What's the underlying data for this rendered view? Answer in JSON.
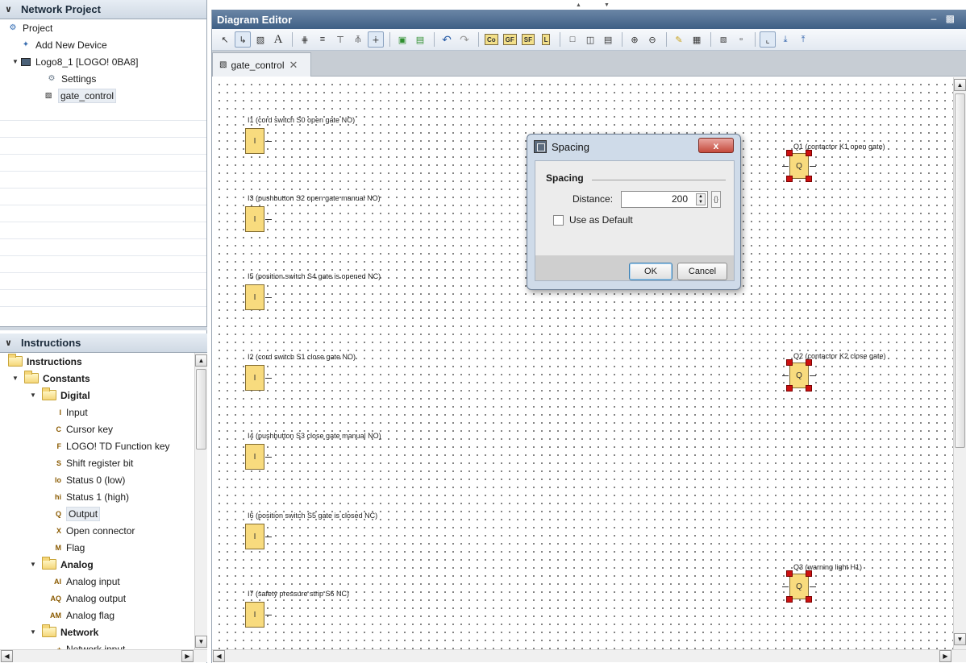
{
  "project_panel": {
    "title": "Network Project",
    "items": [
      {
        "label": "Project"
      },
      {
        "label": "Add New Device"
      },
      {
        "label": "Logo8_1 [LOGO! 0BA8]"
      },
      {
        "label": "Settings"
      },
      {
        "label": "gate_control"
      }
    ]
  },
  "instructions_panel": {
    "title": "Instructions",
    "root": "Instructions",
    "constants": "Constants",
    "digital": "Digital",
    "digital_items": [
      {
        "code": "I",
        "label": "Input"
      },
      {
        "code": "C",
        "label": "Cursor key"
      },
      {
        "code": "F",
        "label": "LOGO! TD Function key"
      },
      {
        "code": "S",
        "label": "Shift register bit"
      },
      {
        "code": "lo",
        "label": "Status 0 (low)"
      },
      {
        "code": "hi",
        "label": "Status 1 (high)"
      },
      {
        "code": "Q",
        "label": "Output"
      },
      {
        "code": "X",
        "label": "Open connector"
      },
      {
        "code": "M",
        "label": "Flag"
      }
    ],
    "analog": "Analog",
    "analog_items": [
      {
        "code": "AI",
        "label": "Analog input"
      },
      {
        "code": "AQ",
        "label": "Analog output"
      },
      {
        "code": "AM",
        "label": "Analog flag"
      }
    ],
    "network": "Network",
    "network_items": [
      {
        "code": "+",
        "label": "Network input"
      }
    ]
  },
  "editor": {
    "title": "Diagram Editor",
    "toolbar_text": {
      "text_tool": "A",
      "co": "Co",
      "gf": "GF",
      "sf": "SF",
      "l": "L"
    },
    "tab": "gate_control",
    "inputs": [
      {
        "name": "I1",
        "label": "I1 (cord switch S0 open gate NO)"
      },
      {
        "name": "I3",
        "label": "I3 (pushbutton S2 open gate manual NO)"
      },
      {
        "name": "I5",
        "label": "I5 (position switch S4 gate is opened NC)"
      },
      {
        "name": "I2",
        "label": "I2 (cord switch S1 close gate NO)"
      },
      {
        "name": "I4",
        "label": "I4 (pushbutton S3 close gate manual NO)"
      },
      {
        "name": "I6",
        "label": "I6 (position switch S5 gate is closed NC)"
      },
      {
        "name": "I7",
        "label": "I7 (safety pressure strip S6 NC)"
      }
    ],
    "input_block_text": "I",
    "outputs": [
      {
        "name": "Q1",
        "label": "Q1 (contactor K1 open gate)"
      },
      {
        "name": "Q2",
        "label": "Q2 (contactor K2 close gate)"
      },
      {
        "name": "Q3",
        "label": "Q3 (warning light H1)"
      }
    ],
    "output_block_text": "Q"
  },
  "dialog": {
    "title": "Spacing",
    "close_label": "x",
    "group": "Spacing",
    "distance_label": "Distance:",
    "distance_value": "200",
    "default_checkbox": "Use as Default",
    "default_checked": false,
    "ok": "OK",
    "cancel": "Cancel"
  },
  "colors": {
    "block_fill": "#f8db7e",
    "handle": "#cc1111",
    "title_bar": "#4f6e93"
  }
}
